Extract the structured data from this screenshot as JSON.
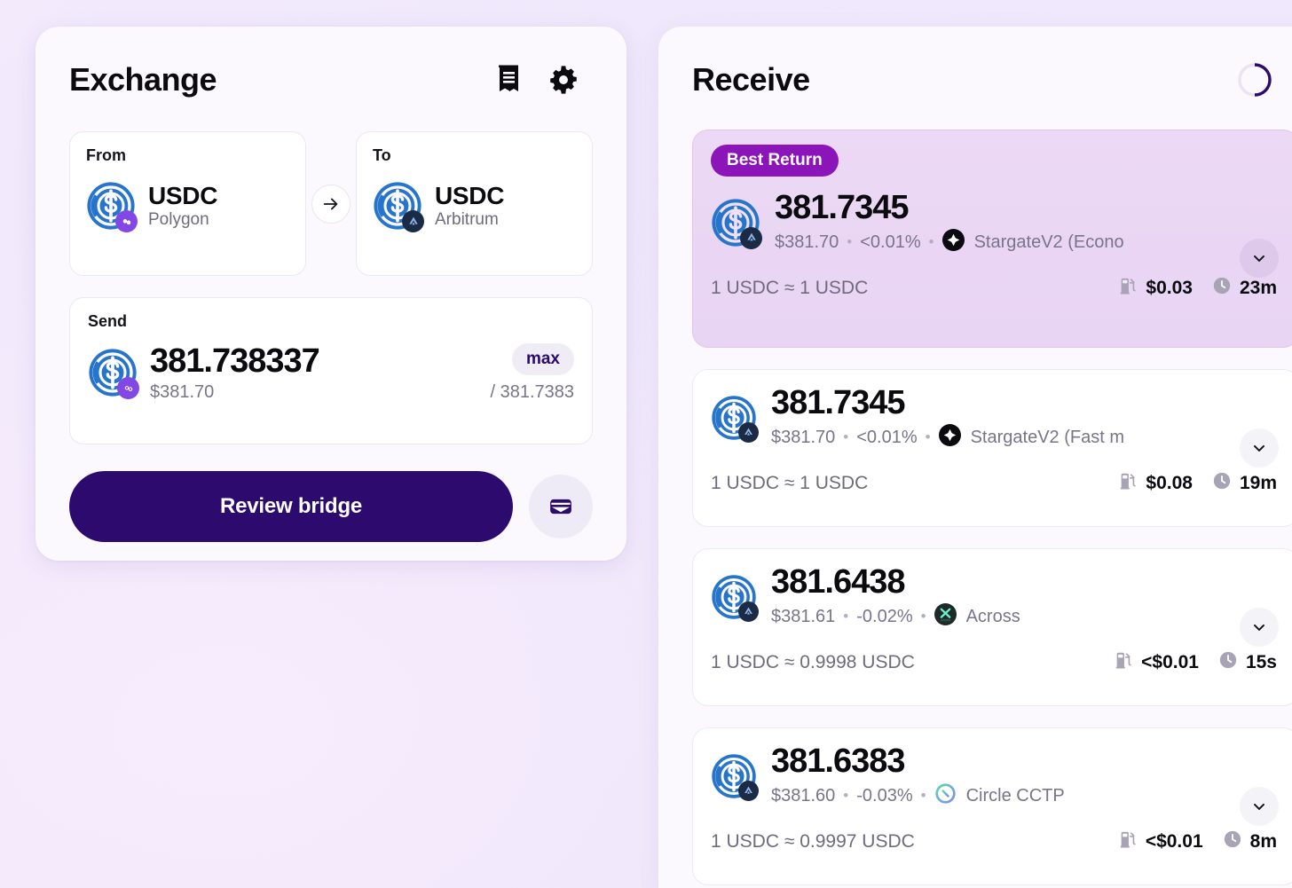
{
  "exchange": {
    "title": "Exchange",
    "icons": {
      "receipt": "receipt-icon",
      "settings": "gear-icon"
    },
    "from": {
      "label": "From",
      "symbol": "USDC",
      "chain": "Polygon",
      "token_icon": "usdc-icon",
      "chain_icon": "polygon-icon"
    },
    "to": {
      "label": "To",
      "symbol": "USDC",
      "chain": "Arbitrum",
      "token_icon": "usdc-icon",
      "chain_icon": "arbitrum-icon"
    },
    "swap_arrow_icon": "arrow-right-icon",
    "send": {
      "label": "Send",
      "amount": "381.738337",
      "usd_value": "$381.70",
      "max_label": "max",
      "balance": "/ 381.7383",
      "token_icon": "usdc-icon",
      "chain_icon": "polygon-icon"
    },
    "review_button": "Review bridge",
    "wallet_button_icon": "wallet-icon"
  },
  "receive": {
    "title": "Receive",
    "loading_icon": "spinner-icon",
    "quotes": [
      {
        "badge": "Best Return",
        "amount": "381.7345",
        "usd_value": "$381.70",
        "diff": "<0.01%",
        "provider": "StargateV2 (Econo",
        "provider_icon": "stargate-icon",
        "rate": "1 USDC ≈ 1 USDC",
        "gas": "$0.03",
        "time": "23m",
        "gas_icon": "gas-pump-icon",
        "time_icon": "clock-icon",
        "expand_icon": "chevron-down-icon"
      },
      {
        "badge": "",
        "amount": "381.7345",
        "usd_value": "$381.70",
        "diff": "<0.01%",
        "provider": "StargateV2 (Fast m",
        "provider_icon": "stargate-icon",
        "rate": "1 USDC ≈ 1 USDC",
        "gas": "$0.08",
        "time": "19m",
        "gas_icon": "gas-pump-icon",
        "time_icon": "clock-icon",
        "expand_icon": "chevron-down-icon"
      },
      {
        "badge": "",
        "amount": "381.6438",
        "usd_value": "$381.61",
        "diff": "-0.02%",
        "provider": "Across",
        "provider_icon": "across-icon",
        "rate": "1 USDC ≈ 0.9998 USDC",
        "gas": "<$0.01",
        "time": "15s",
        "gas_icon": "gas-pump-icon",
        "time_icon": "clock-icon",
        "expand_icon": "chevron-down-icon"
      },
      {
        "badge": "",
        "amount": "381.6383",
        "usd_value": "$381.60",
        "diff": "-0.03%",
        "provider": "Circle CCTP",
        "provider_icon": "circle-cctp-icon",
        "rate": "1 USDC ≈ 0.9997 USDC",
        "gas": "<$0.01",
        "time": "8m",
        "gas_icon": "gas-pump-icon",
        "time_icon": "clock-icon",
        "expand_icon": "chevron-down-icon"
      }
    ]
  },
  "colors": {
    "brand_primary": "#2d0a6e",
    "badge_purple": "#8c15b9",
    "usdc_blue": "#2775ca",
    "polygon_purple": "#8247e5",
    "arbitrum_navy": "#1b2b45",
    "card_white": "#ffffff",
    "panel_bg": "#fbf9fe",
    "best_card_bg": "#e9d6f4"
  }
}
